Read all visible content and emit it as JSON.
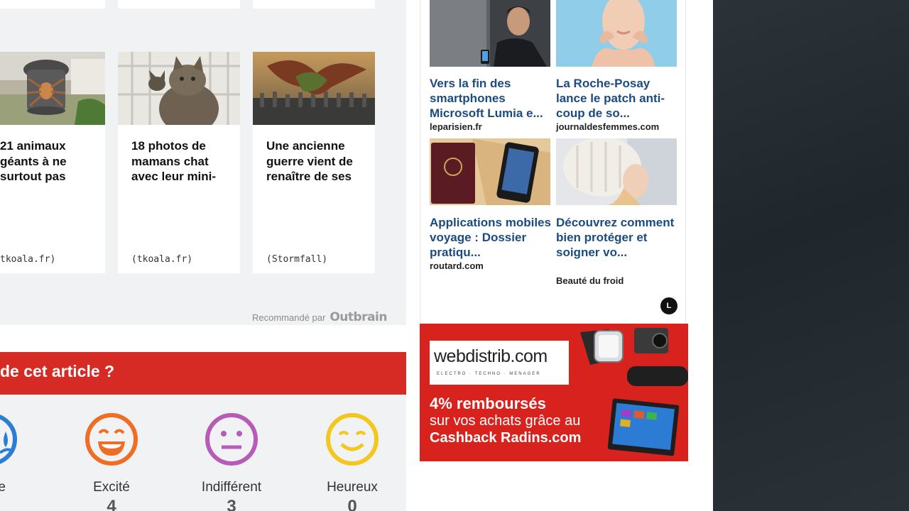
{
  "recommended": {
    "cards": [
      {
        "title": "21 animaux géants à ne surtout pas",
        "source": "tkoala.fr)",
        "image_icon": "trash-can-spider-photo"
      },
      {
        "title": "18 photos de mamans chat avec leur mini-",
        "source": "(tkoala.fr)",
        "image_icon": "cat-photo"
      },
      {
        "title": "Une ancienne guerre vient de renaître de ses",
        "source": "(Stormfall)",
        "image_icon": "dragon-army-photo"
      }
    ],
    "credit_label": "Recommandé par",
    "credit_brand": "Outbrain"
  },
  "reactions": {
    "question": "de cet article ?",
    "accent_color": "#d62b24",
    "items": [
      {
        "label": "te",
        "count": "",
        "color": "#2a7fd4",
        "icon": "sad-face-icon"
      },
      {
        "label": "Excité",
        "count": "4",
        "color": "#ef6d25",
        "icon": "excited-face-icon"
      },
      {
        "label": "Indifférent",
        "count": "3",
        "color": "#b65cb8",
        "icon": "neutral-face-icon"
      },
      {
        "label": "Heureux",
        "count": "0",
        "color": "#f3c71d",
        "icon": "happy-face-icon"
      }
    ]
  },
  "sponsored": {
    "items": [
      {
        "title": "Vers la fin des smartphones Microsoft Lumia e...",
        "source": "leparisien.fr",
        "image_icon": "presenter-photo"
      },
      {
        "title": "La Roche-Posay lance le patch anti-coup de so...",
        "source": "journaldesfemmes.com",
        "image_icon": "woman-face-photo"
      },
      {
        "title": "Applications mobiles voyage : Dossier pratiqu...",
        "source": "routard.com",
        "image_icon": "passport-phone-photo"
      },
      {
        "title": "Découvrez comment bien protéger et soigner vo...",
        "source": "Beauté du froid",
        "image_icon": "woman-winter-hat-photo"
      }
    ],
    "badge": "L"
  },
  "banner": {
    "logo": "webdistrib.com",
    "logo_tagline": "ELECTRO · TECHNO · MENAGER",
    "line1": "4% remboursés",
    "line2": "sur vos achats grâce au",
    "line3": "Cashback Radins.com",
    "color": "#d8221d"
  }
}
